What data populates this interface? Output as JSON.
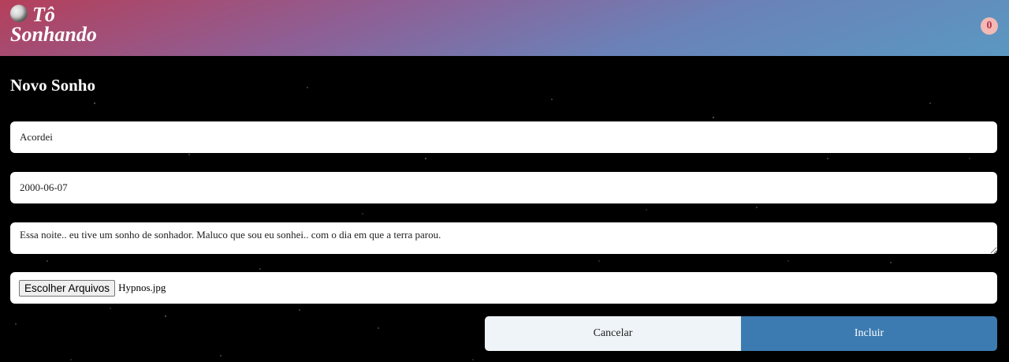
{
  "header": {
    "brand_line1": "Tô",
    "brand_line2": "Sonhando",
    "logo_icon": "moon-icon",
    "badge_count": "0"
  },
  "form": {
    "title": "Novo Sonho",
    "title_value": "Acordei",
    "date_value": "2000-06-07",
    "description_value": "Essa noite.. eu tive um sonho de sonhador. Maluco que sou eu sonhei.. com o dia em que a terra parou.",
    "file_button_label": "Escolher Arquivos",
    "file_name": "Hypnos.jpg",
    "cancel_label": "Cancelar",
    "submit_label": "Incluir"
  },
  "colors": {
    "header_gradient_start": "#b53f5a",
    "header_gradient_end": "#5a98c2",
    "background": "#000000",
    "badge_bg": "#f3b9b4",
    "badge_text": "#b8324a",
    "submit_bg": "#3c7bb1",
    "cancel_bg": "#eef4f7"
  }
}
